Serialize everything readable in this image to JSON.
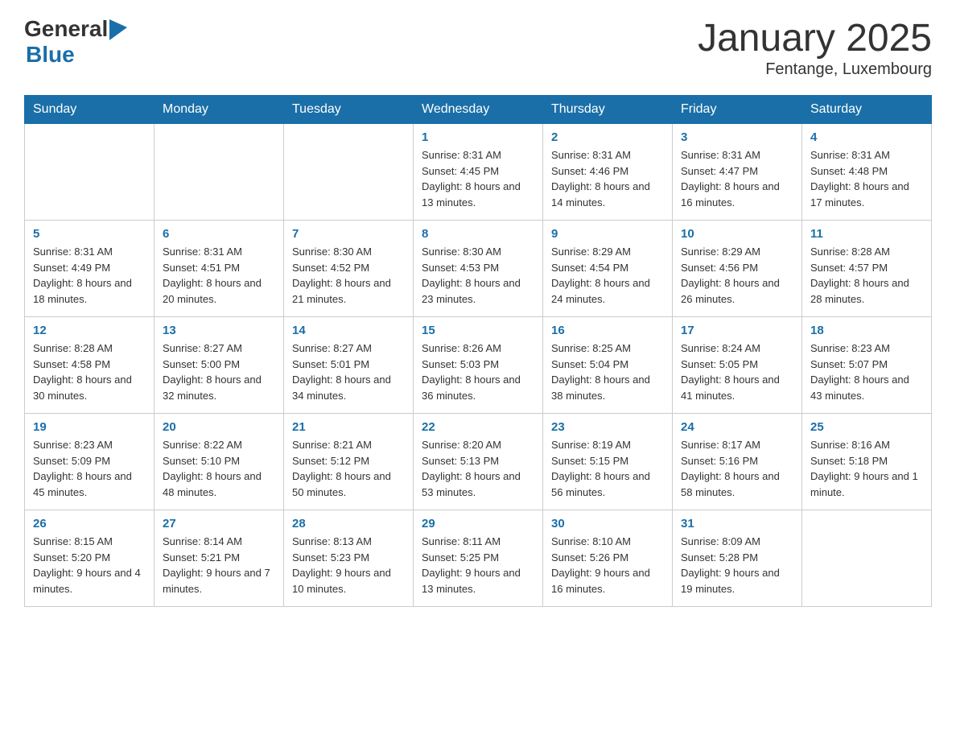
{
  "logo": {
    "general": "General",
    "blue": "Blue"
  },
  "header": {
    "title": "January 2025",
    "subtitle": "Fentange, Luxembourg"
  },
  "days_of_week": [
    "Sunday",
    "Monday",
    "Tuesday",
    "Wednesday",
    "Thursday",
    "Friday",
    "Saturday"
  ],
  "weeks": [
    [
      {
        "day": "",
        "sunrise": "",
        "sunset": "",
        "daylight": ""
      },
      {
        "day": "",
        "sunrise": "",
        "sunset": "",
        "daylight": ""
      },
      {
        "day": "",
        "sunrise": "",
        "sunset": "",
        "daylight": ""
      },
      {
        "day": "1",
        "sunrise": "Sunrise: 8:31 AM",
        "sunset": "Sunset: 4:45 PM",
        "daylight": "Daylight: 8 hours and 13 minutes."
      },
      {
        "day": "2",
        "sunrise": "Sunrise: 8:31 AM",
        "sunset": "Sunset: 4:46 PM",
        "daylight": "Daylight: 8 hours and 14 minutes."
      },
      {
        "day": "3",
        "sunrise": "Sunrise: 8:31 AM",
        "sunset": "Sunset: 4:47 PM",
        "daylight": "Daylight: 8 hours and 16 minutes."
      },
      {
        "day": "4",
        "sunrise": "Sunrise: 8:31 AM",
        "sunset": "Sunset: 4:48 PM",
        "daylight": "Daylight: 8 hours and 17 minutes."
      }
    ],
    [
      {
        "day": "5",
        "sunrise": "Sunrise: 8:31 AM",
        "sunset": "Sunset: 4:49 PM",
        "daylight": "Daylight: 8 hours and 18 minutes."
      },
      {
        "day": "6",
        "sunrise": "Sunrise: 8:31 AM",
        "sunset": "Sunset: 4:51 PM",
        "daylight": "Daylight: 8 hours and 20 minutes."
      },
      {
        "day": "7",
        "sunrise": "Sunrise: 8:30 AM",
        "sunset": "Sunset: 4:52 PM",
        "daylight": "Daylight: 8 hours and 21 minutes."
      },
      {
        "day": "8",
        "sunrise": "Sunrise: 8:30 AM",
        "sunset": "Sunset: 4:53 PM",
        "daylight": "Daylight: 8 hours and 23 minutes."
      },
      {
        "day": "9",
        "sunrise": "Sunrise: 8:29 AM",
        "sunset": "Sunset: 4:54 PM",
        "daylight": "Daylight: 8 hours and 24 minutes."
      },
      {
        "day": "10",
        "sunrise": "Sunrise: 8:29 AM",
        "sunset": "Sunset: 4:56 PM",
        "daylight": "Daylight: 8 hours and 26 minutes."
      },
      {
        "day": "11",
        "sunrise": "Sunrise: 8:28 AM",
        "sunset": "Sunset: 4:57 PM",
        "daylight": "Daylight: 8 hours and 28 minutes."
      }
    ],
    [
      {
        "day": "12",
        "sunrise": "Sunrise: 8:28 AM",
        "sunset": "Sunset: 4:58 PM",
        "daylight": "Daylight: 8 hours and 30 minutes."
      },
      {
        "day": "13",
        "sunrise": "Sunrise: 8:27 AM",
        "sunset": "Sunset: 5:00 PM",
        "daylight": "Daylight: 8 hours and 32 minutes."
      },
      {
        "day": "14",
        "sunrise": "Sunrise: 8:27 AM",
        "sunset": "Sunset: 5:01 PM",
        "daylight": "Daylight: 8 hours and 34 minutes."
      },
      {
        "day": "15",
        "sunrise": "Sunrise: 8:26 AM",
        "sunset": "Sunset: 5:03 PM",
        "daylight": "Daylight: 8 hours and 36 minutes."
      },
      {
        "day": "16",
        "sunrise": "Sunrise: 8:25 AM",
        "sunset": "Sunset: 5:04 PM",
        "daylight": "Daylight: 8 hours and 38 minutes."
      },
      {
        "day": "17",
        "sunrise": "Sunrise: 8:24 AM",
        "sunset": "Sunset: 5:05 PM",
        "daylight": "Daylight: 8 hours and 41 minutes."
      },
      {
        "day": "18",
        "sunrise": "Sunrise: 8:23 AM",
        "sunset": "Sunset: 5:07 PM",
        "daylight": "Daylight: 8 hours and 43 minutes."
      }
    ],
    [
      {
        "day": "19",
        "sunrise": "Sunrise: 8:23 AM",
        "sunset": "Sunset: 5:09 PM",
        "daylight": "Daylight: 8 hours and 45 minutes."
      },
      {
        "day": "20",
        "sunrise": "Sunrise: 8:22 AM",
        "sunset": "Sunset: 5:10 PM",
        "daylight": "Daylight: 8 hours and 48 minutes."
      },
      {
        "day": "21",
        "sunrise": "Sunrise: 8:21 AM",
        "sunset": "Sunset: 5:12 PM",
        "daylight": "Daylight: 8 hours and 50 minutes."
      },
      {
        "day": "22",
        "sunrise": "Sunrise: 8:20 AM",
        "sunset": "Sunset: 5:13 PM",
        "daylight": "Daylight: 8 hours and 53 minutes."
      },
      {
        "day": "23",
        "sunrise": "Sunrise: 8:19 AM",
        "sunset": "Sunset: 5:15 PM",
        "daylight": "Daylight: 8 hours and 56 minutes."
      },
      {
        "day": "24",
        "sunrise": "Sunrise: 8:17 AM",
        "sunset": "Sunset: 5:16 PM",
        "daylight": "Daylight: 8 hours and 58 minutes."
      },
      {
        "day": "25",
        "sunrise": "Sunrise: 8:16 AM",
        "sunset": "Sunset: 5:18 PM",
        "daylight": "Daylight: 9 hours and 1 minute."
      }
    ],
    [
      {
        "day": "26",
        "sunrise": "Sunrise: 8:15 AM",
        "sunset": "Sunset: 5:20 PM",
        "daylight": "Daylight: 9 hours and 4 minutes."
      },
      {
        "day": "27",
        "sunrise": "Sunrise: 8:14 AM",
        "sunset": "Sunset: 5:21 PM",
        "daylight": "Daylight: 9 hours and 7 minutes."
      },
      {
        "day": "28",
        "sunrise": "Sunrise: 8:13 AM",
        "sunset": "Sunset: 5:23 PM",
        "daylight": "Daylight: 9 hours and 10 minutes."
      },
      {
        "day": "29",
        "sunrise": "Sunrise: 8:11 AM",
        "sunset": "Sunset: 5:25 PM",
        "daylight": "Daylight: 9 hours and 13 minutes."
      },
      {
        "day": "30",
        "sunrise": "Sunrise: 8:10 AM",
        "sunset": "Sunset: 5:26 PM",
        "daylight": "Daylight: 9 hours and 16 minutes."
      },
      {
        "day": "31",
        "sunrise": "Sunrise: 8:09 AM",
        "sunset": "Sunset: 5:28 PM",
        "daylight": "Daylight: 9 hours and 19 minutes."
      },
      {
        "day": "",
        "sunrise": "",
        "sunset": "",
        "daylight": ""
      }
    ]
  ]
}
